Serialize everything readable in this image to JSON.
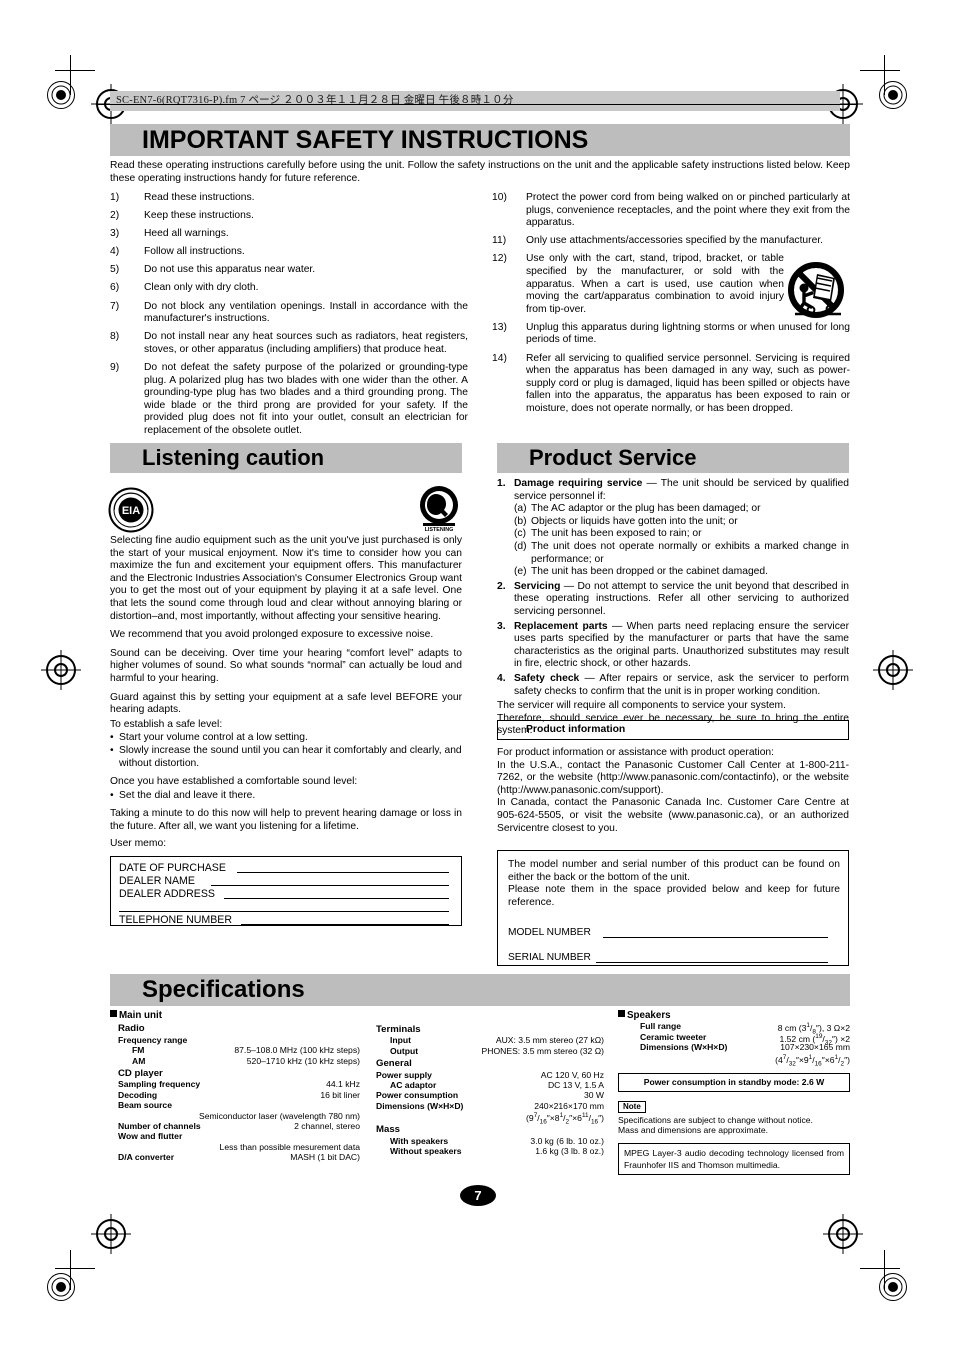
{
  "header": {
    "file_line": "SC-EN7-6(RQT7316-P).fm   7 ページ   ２００３年１１月２８日   金曜日   午後８時１０分"
  },
  "safety": {
    "title": "IMPORTANT SAFETY INSTRUCTIONS",
    "intro": "Read these operating instructions carefully before using the unit. Follow the safety instructions on the unit and the applicable safety instructions listed below. Keep these operating instructions handy for future reference.",
    "items_left": [
      {
        "num": "1)",
        "text": "Read these instructions."
      },
      {
        "num": "2)",
        "text": "Keep these instructions."
      },
      {
        "num": "3)",
        "text": "Heed all warnings."
      },
      {
        "num": "4)",
        "text": "Follow all instructions."
      },
      {
        "num": "5)",
        "text": "Do not use this apparatus near water."
      },
      {
        "num": "6)",
        "text": "Clean only with dry cloth."
      },
      {
        "num": "7)",
        "text": "Do not block any ventilation openings. Install in accordance with the manufacturer's instructions."
      },
      {
        "num": "8)",
        "text": "Do not install near any heat sources such as radiators, heat registers, stoves, or other apparatus (including amplifiers) that produce heat."
      },
      {
        "num": "9)",
        "text": "Do not defeat the safety purpose of the polarized or grounding-type plug. A polarized plug has two blades with one wider than the other. A grounding-type plug has two blades and a third grounding prong. The wide blade or the third prong are provided for your safety. If the provided plug does not fit into your outlet, consult an electrician for replacement of the obsolete outlet."
      }
    ],
    "items_right": [
      {
        "num": "10)",
        "text": "Protect the power cord from being walked on or pinched particularly at plugs, convenience receptacles, and the point where they exit from the apparatus."
      },
      {
        "num": "11)",
        "text": "Only use attachments/accessories specified by the manufacturer."
      },
      {
        "num": "12)",
        "text": "Use only with the cart, stand, tripod, bracket, or table specified by the manufacturer, or sold with the apparatus. When a cart is used, use caution when moving the cart/apparatus combination to avoid injury from tip-over."
      },
      {
        "num": "13)",
        "text": "Unplug this apparatus during lightning storms or when unused for long periods of time."
      },
      {
        "num": "14)",
        "text": "Refer all servicing to qualified service personnel. Servicing is required when the apparatus has been damaged in any way, such as power-supply cord or plug is damaged, liquid has been spilled or objects have fallen into the apparatus, the apparatus has been exposed to rain or moisture, does not operate normally, or has been dropped."
      }
    ]
  },
  "listening": {
    "title": "Listening caution",
    "logo_left": "EIA",
    "logo_left_ring": "ELECTRONIC INDUSTRIES ALLIANCE",
    "logo_right": "Q",
    "logo_right_caption": "LISTENING",
    "paragraphs": [
      "Selecting fine audio equipment such as the unit you've just purchased is only the start of your musical enjoyment. Now it's time to consider how you can maximize the fun and excitement your equipment offers. This manufacturer and the Electronic Industries Association's Consumer Electronics Group want you to get the most out of your equipment by playing it at a safe level. One that lets the sound come through loud and clear without annoying blaring or distortion–and, most importantly, without affecting your sensitive hearing.",
      "We recommend that you avoid prolonged exposure to excessive noise.",
      "Sound can be deceiving. Over time your hearing “comfort level” adapts to higher volumes of sound. So what sounds “normal” can actually be loud and harmful to your hearing."
    ],
    "guard": "Guard against this by setting your equipment at a safe level BEFORE your hearing adapts.",
    "establish_label": "To establish a safe level:",
    "establish_bullets": [
      "Start your volume control at a low setting.",
      "Slowly increase the sound until you can hear it comfortably and clearly, and without distortion."
    ],
    "once_label": "Once you have established a comfortable sound level:",
    "once_bullets": [
      "Set the dial and leave it there."
    ],
    "closing": "Taking a minute to do this now will help to prevent hearing damage or loss in the future. After all, we want you listening for a lifetime.",
    "memo_label": "User memo:",
    "memo_rows": [
      "DATE OF PURCHASE",
      "DEALER NAME",
      "DEALER ADDRESS",
      "TELEPHONE NUMBER"
    ]
  },
  "service": {
    "title": "Product Service",
    "items": [
      {
        "num": "1.",
        "lead": "Damage requiring service",
        "dash": " — ",
        "text": "The unit should be serviced by qualified service personnel if:",
        "subs": [
          {
            "lbl": "(a)",
            "text": "The AC adaptor or the plug has been damaged; or"
          },
          {
            "lbl": "(b)",
            "text": "Objects or liquids have gotten into the unit; or"
          },
          {
            "lbl": "(c)",
            "text": "The unit has been exposed to rain; or"
          },
          {
            "lbl": "(d)",
            "text": "The unit does not operate normally or exhibits a marked change in performance; or"
          },
          {
            "lbl": "(e)",
            "text": "The unit has been dropped or the cabinet damaged."
          }
        ]
      },
      {
        "num": "2.",
        "lead": "Servicing",
        "dash": " — ",
        "text": "Do not attempt to service the unit beyond that described in these operating instructions. Refer all other servicing to authorized servicing personnel.",
        "subs": []
      },
      {
        "num": "3.",
        "lead": "Replacement parts",
        "dash": " — ",
        "text": "When parts need replacing ensure the servicer uses parts specified by the manufacturer or parts that have the same characteristics as the original parts. Unauthorized substitutes may result in fire, electric shock, or other hazards.",
        "subs": []
      },
      {
        "num": "4.",
        "lead": "Safety check",
        "dash": " — ",
        "text": "After repairs or service, ask the servicer to perform safety checks to confirm that the unit is in proper working condition.",
        "subs": []
      }
    ],
    "tail1": "The servicer will require all components to service your system.",
    "tail2": "Therefore, should service ever be necessary, be sure to bring the entire system.",
    "info_box_title": "Product information",
    "info_lines": [
      "For product information or assistance with product operation:",
      "In the U.S.A., contact the Panasonic Customer Call Center at 1-800-211-7262, or the website (http://www.panasonic.com/contactinfo), or the website (http://www.panasonic.com/support).",
      "In Canada, contact the Panasonic Canada Inc. Customer Care Centre at 905-624-5505, or visit the website (www.panasonic.ca), or an authorized Servicentre closest to you."
    ],
    "model_box": {
      "line1": "The model number and serial number of this product can be found on either the back or the bottom of the unit.",
      "line2": "Please note them in the space provided below and keep for future reference.",
      "model_label": "MODEL NUMBER",
      "serial_label": "SERIAL NUMBER"
    }
  },
  "specifications": {
    "title": "Specifications",
    "col1": {
      "heading": "Main unit",
      "groups": [
        {
          "name": "Radio",
          "rows": [
            {
              "k": "Frequency range",
              "v": "",
              "indent": 0
            },
            {
              "k": "FM",
              "v": "87.5–108.0 MHz (100 kHz steps)",
              "indent": 1
            },
            {
              "k": "AM",
              "v": "520–1710 kHz (10 kHz steps)",
              "indent": 1
            }
          ]
        },
        {
          "name": "CD player",
          "rows": [
            {
              "k": "Sampling frequency",
              "v": "44.1 kHz",
              "indent": 0
            },
            {
              "k": "Decoding",
              "v": "16 bit liner",
              "indent": 0
            },
            {
              "k": "Beam source",
              "v": "",
              "indent": 0
            },
            {
              "k": "",
              "v": "Semiconductor laser (wavelength 780 nm)",
              "indent": 0,
              "full": true
            },
            {
              "k": "Number of channels",
              "v": "2 channel, stereo",
              "indent": 0
            },
            {
              "k": "Wow and flutter",
              "v": "",
              "indent": 0
            },
            {
              "k": "",
              "v": "Less than possible mesurement data",
              "indent": 0,
              "full": true
            },
            {
              "k": "D/A converter",
              "v": "MASH (1 bit DAC)",
              "indent": 0
            }
          ]
        }
      ]
    },
    "col2": {
      "groups": [
        {
          "name": "Terminals",
          "rows": [
            {
              "k": "Input",
              "v": "AUX: 3.5 mm stereo (27 kΩ)",
              "indent": 1
            },
            {
              "k": "Output",
              "v": "PHONES: 3.5 mm stereo (32 Ω)",
              "indent": 1
            }
          ]
        },
        {
          "name": "General",
          "rows": [
            {
              "k": "Power supply",
              "v": "AC 120 V, 60 Hz",
              "indent": 0
            },
            {
              "k": "AC adaptor",
              "v": "DC 13 V, 1.5 A",
              "indent": 1
            },
            {
              "k": "Power consumption",
              "v": "30 W",
              "indent": 0
            },
            {
              "k": "Dimensions (W×H×D)",
              "v": "240×216×170 mm",
              "indent": 0
            }
          ],
          "inch_note": "(9 7/16″×8 1/2″×6 11/16″)"
        },
        {
          "name": "Mass",
          "rows": [
            {
              "k": "With speakers",
              "v": "3.0 kg (6 lb. 10 oz.)",
              "indent": 1
            },
            {
              "k": "Without speakers",
              "v": "1.6 kg (3 lb. 8 oz.)",
              "indent": 1
            }
          ]
        }
      ]
    },
    "col3": {
      "heading": "Speakers",
      "rows": [
        {
          "k": "Full range",
          "v": "8 cm (3 1/8″), 3 Ω×2",
          "indent": 1
        },
        {
          "k": "Ceramic tweeter",
          "v": "1.52 cm (19/32″) ×2",
          "indent": 1
        },
        {
          "k": "Dimensions (W×H×D)",
          "v": "107×230×165 mm",
          "indent": 1
        }
      ],
      "inch_note": "(4 7/32″×9 1/16″×6 1/2″)",
      "standby_box": "Power consumption in standby mode: 2.6 W",
      "note_tag": "Note",
      "note_lines": [
        "Specifications are subject to change without notice.",
        "Mass and dimensions are approximate."
      ],
      "mpeg_box": "MPEG Layer-3 audio decoding technology licensed from Fraunhofer IIS and Thomson multimedia."
    }
  },
  "page_number": "7"
}
